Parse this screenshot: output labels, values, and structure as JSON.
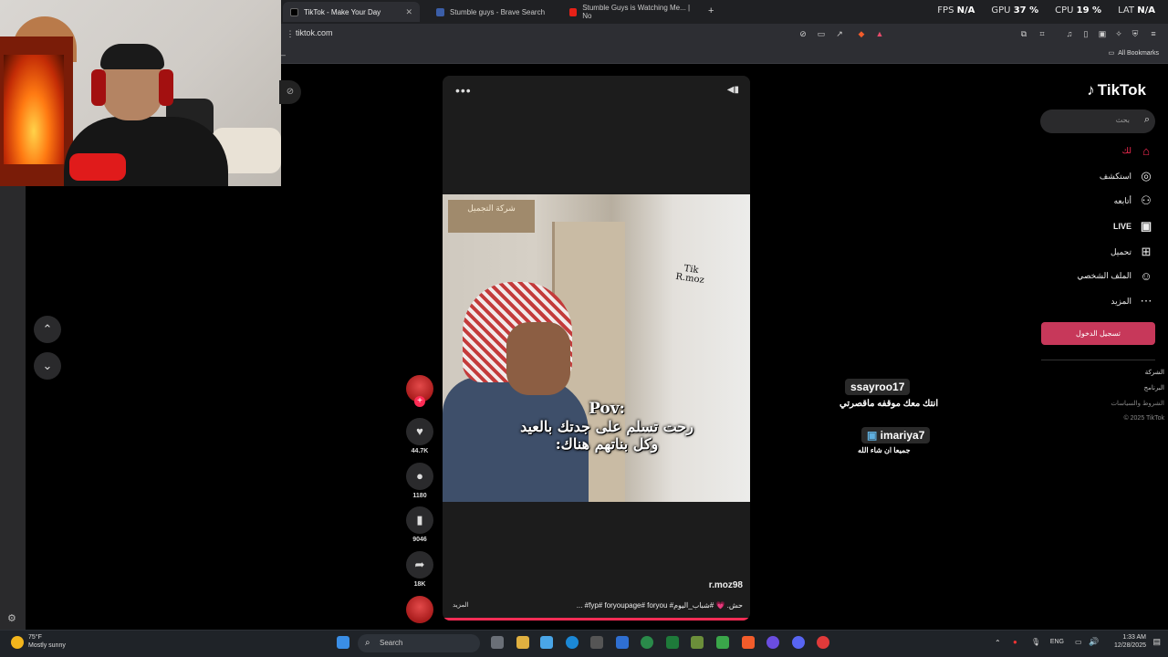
{
  "browser": {
    "tabs": [
      {
        "label": "TikTok - Make Your Day",
        "active": true
      },
      {
        "label": "Stumble guys - Brave Search",
        "active": false
      },
      {
        "label": "Stumble Guys is Watching Me... | No",
        "active": false
      }
    ],
    "new_tab": "+",
    "url": "tiktok.com",
    "all_bookmarks": "All Bookmarks"
  },
  "overlay_stats": {
    "fps_label": "FPS",
    "fps_value": "N/A",
    "gpu_label": "GPU",
    "gpu_value": "37 %",
    "cpu_label": "CPU",
    "cpu_value": "19 %",
    "lat_label": "LAT",
    "lat_value": "N/A"
  },
  "tiktok": {
    "logo": "TikTok",
    "search_placeholder": "بحث",
    "nav": [
      {
        "label": "لك",
        "icon": "home-icon"
      },
      {
        "label": "استكشف",
        "icon": "compass-icon"
      },
      {
        "label": "أتابعه",
        "icon": "following-icon"
      },
      {
        "label": "LIVE",
        "icon": "live-icon"
      },
      {
        "label": "تحميل",
        "icon": "upload-icon"
      },
      {
        "label": "الملف الشخصي",
        "icon": "profile-icon"
      },
      {
        "label": "المزيد",
        "icon": "more-icon"
      }
    ],
    "login_button": "تسجيل الدخول",
    "footer": [
      "الشركة",
      "البرنامج",
      "الشروط والسياسات",
      "© 2025 TikTok"
    ],
    "video": {
      "author": "r.moz98",
      "caption": "حش. 💗 #شباب_اليوم# fyp# foryoupage# foryou# ...",
      "more": "المزيد",
      "watermark_l1": "Tik",
      "watermark_l2": "R.moz",
      "sign_text": "شركة التجميل",
      "overlay_l1": "Pov:",
      "overlay_l2": "رحت تسلم على جدتك بالعيد",
      "overlay_l3": "وكل بناتهم هناك:",
      "progress": 1.0
    },
    "actions": {
      "likes": "44.7K",
      "comments": "1180",
      "saves": "9046",
      "shares": "18K"
    },
    "comments_overlay": [
      {
        "user": "ssayroo17",
        "text": "انتك معك موقفه ماقصرتي"
      },
      {
        "user": "imariya7",
        "text": "جميعا ان شاء الله"
      }
    ]
  },
  "taskbar": {
    "weather_temp": "75°F",
    "weather_desc": "Mostly sunny",
    "search": "Search",
    "lang": "ENG",
    "time": "1:33 AM",
    "date": "12/28/2025"
  },
  "colors": {
    "accent": "#fe2c55",
    "login_bg": "#c7385a",
    "chrome_bg": "#2d2e33"
  }
}
